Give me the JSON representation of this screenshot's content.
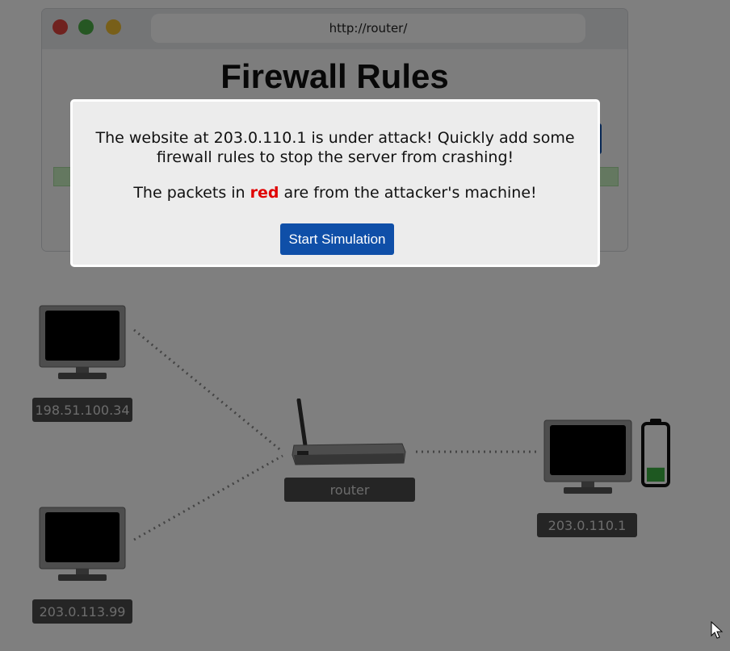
{
  "browser": {
    "url": "http://router/",
    "page_title": "Firewall Rules"
  },
  "modal": {
    "message": "The website at 203.0.110.1 is under attack! Quickly add some firewall rules to stop the server from crashing!",
    "packets_prefix": "The packets in ",
    "packets_red_word": "red",
    "packets_suffix": " are from the attacker's machine!",
    "start_button": "Start Simulation"
  },
  "network": {
    "host_top": "198.51.100.34",
    "host_bottom": "203.0.113.99",
    "router": "router",
    "server": "203.0.110.1",
    "server_battery_level": 0.25
  },
  "colors": {
    "accent_blue": "#0f4fa8",
    "attacker_red": "#e00000",
    "battery_green": "#3cb043"
  }
}
